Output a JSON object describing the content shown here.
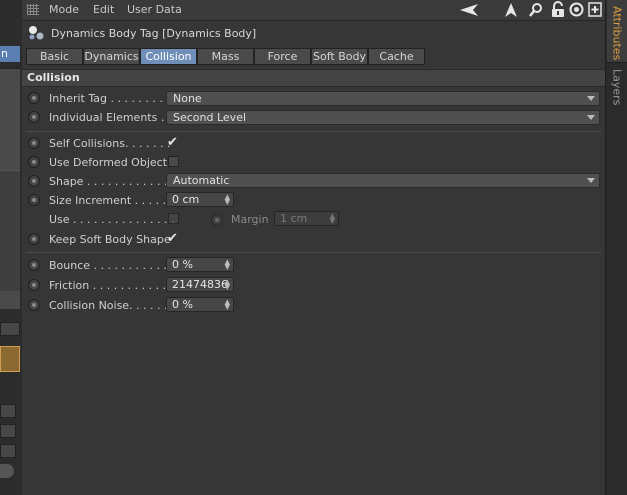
{
  "menubar": {
    "items": [
      "Mode",
      "Edit",
      "User Data"
    ]
  },
  "header": {
    "title": "Dynamics Body Tag [Dynamics Body]"
  },
  "tabs": [
    "Basic",
    "Dynamics",
    "Collision",
    "Mass",
    "Force",
    "Soft Body",
    "Cache"
  ],
  "active_tab": "Collision",
  "section": {
    "title": "Collision"
  },
  "fields": {
    "inherit_tag": {
      "label": "Inherit Tag . . . . . . . . .",
      "value": "None"
    },
    "individual_elements": {
      "label": "Individual Elements . .",
      "value": "Second Level"
    },
    "self_collisions": {
      "label": "Self Collisions. . . . . . .",
      "checked": true
    },
    "use_deformed_object": {
      "label": "Use Deformed Object",
      "checked": false
    },
    "shape": {
      "label": "Shape . . . . . . . . . . . . .",
      "value": "Automatic"
    },
    "size_increment": {
      "label": "Size Increment . . . . . .",
      "value": "0 cm"
    },
    "use": {
      "label": "Use . . . . . . . . . . . . . . .",
      "checked": false
    },
    "margin": {
      "label": "Margin",
      "value": "1 cm"
    },
    "keep_soft_body_shape": {
      "label": "Keep Soft Body Shape",
      "checked": true
    },
    "bounce": {
      "label": "Bounce . . . . . . . . . . . .",
      "value": "0 %"
    },
    "friction": {
      "label": "Friction . . . . . . . . . . . .",
      "value": "21474836"
    },
    "collision_noise": {
      "label": "Collision Noise. . . . . .",
      "value": "0 %"
    }
  },
  "vtabs": [
    "Attributes",
    "Layers"
  ],
  "left_tab": {
    "label": "n"
  },
  "colors": {
    "accent_tab": "#6f8fb8",
    "vtab_active": "#e0a040"
  },
  "icons": [
    "grid-icon",
    "back-arrow-icon",
    "cursor-up-icon",
    "search-icon",
    "lock-icon",
    "target-icon",
    "new-panel-icon",
    "tag-spheres-icon"
  ]
}
